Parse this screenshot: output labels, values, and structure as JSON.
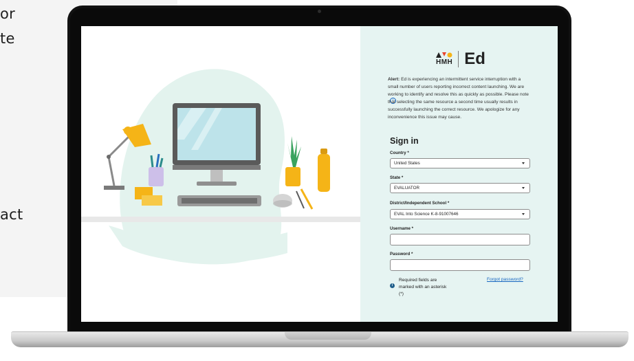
{
  "background_page": {
    "line1": "or",
    "line2": "te",
    "line3": "act"
  },
  "brand": {
    "hmh": "HMH",
    "product": "Ed"
  },
  "alert": {
    "title": "Alert:",
    "message": "Ed is experiencing an intermittent service interruption with a small number of users reporting incorrect content launching. We are working to identify and resolve this as quickly as possible. Please note that selecting the same resource a second time usually results in successfully launching the correct resource. We apologize for any inconvenience this issue may cause."
  },
  "signin": {
    "title": "Sign in",
    "country_label": "Country *",
    "country_value": "United States",
    "state_label": "State *",
    "state_value": "EVALUATOR",
    "district_label": "District/Independent School *",
    "district_value": "EVAL Into Science K-8-91007646",
    "username_label": "Username *",
    "username_value": "",
    "password_label": "Password *",
    "password_value": "",
    "required_note": "Required fields are marked with an asterisk (*)",
    "forgot_link": "Forgot password?"
  },
  "colors": {
    "panel_bg": "#e6f4f2",
    "link": "#1565c0",
    "lamp": "#f5b417",
    "monitor": "#5a5a5a",
    "blob": "#e3f3ee"
  }
}
